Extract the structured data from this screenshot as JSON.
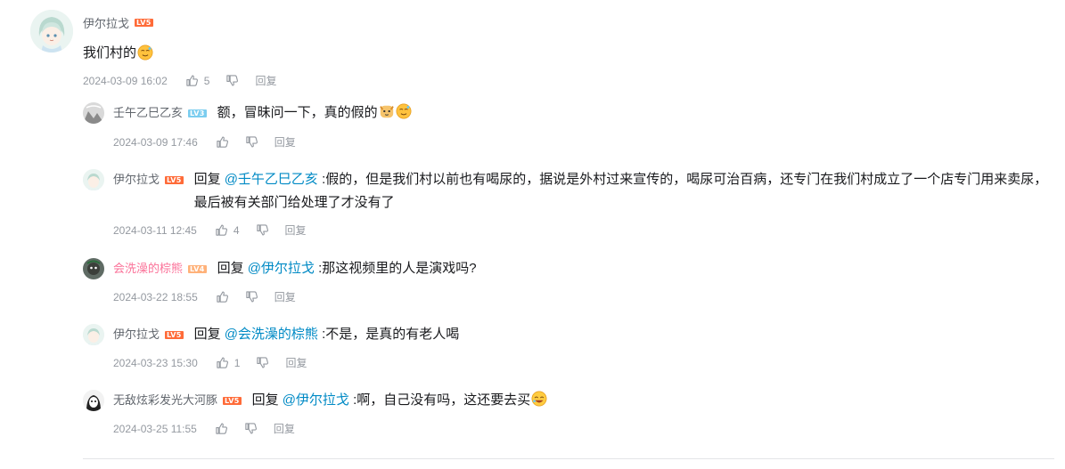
{
  "root": {
    "username": "伊尔拉戈",
    "level": "LV5",
    "text": "我们村的",
    "time": "2024-03-09 16:02",
    "likes": "5",
    "reply_label": "回复"
  },
  "replies": [
    {
      "username": "壬午乙巳乙亥",
      "level": "LV3",
      "prefix": "",
      "at": "",
      "text": "额，冒昧问一下，真的假的",
      "time": "2024-03-09 17:46",
      "likes": "",
      "reply_label": "回复"
    },
    {
      "username": "伊尔拉戈",
      "level": "LV5",
      "prefix": "回复",
      "at": "@壬午乙巳乙亥",
      "text": ":假的，但是我们村以前也有喝尿的，据说是外村过来宣传的，喝尿可治百病，还专门在我们村成立了一个店专门用来卖尿，最后被有关部门给处理了才没有了",
      "time": "2024-03-11 12:45",
      "likes": "4",
      "reply_label": "回复"
    },
    {
      "username": "会洗澡的棕熊",
      "level": "LV4",
      "prefix": "回复",
      "at": "@伊尔拉戈",
      "text": ":那这视频里的人是演戏吗?",
      "time": "2024-03-22 18:55",
      "likes": "",
      "reply_label": "回复"
    },
    {
      "username": "伊尔拉戈",
      "level": "LV5",
      "prefix": "回复",
      "at": "@会洗澡的棕熊",
      "text": ":不是，是真的有老人喝",
      "time": "2024-03-23 15:30",
      "likes": "1",
      "reply_label": "回复"
    },
    {
      "username": "无敌炫彩发光大河豚",
      "level": "LV5",
      "prefix": "回复",
      "at": "@伊尔拉戈",
      "text": ":啊，自己没有吗，这还要去买",
      "time": "2024-03-25 11:55",
      "likes": "",
      "reply_label": "回复"
    }
  ],
  "colors": {
    "lv5": "#ff6b38",
    "lv4": "#ffb27a",
    "lv3": "#7bcdef",
    "mention": "#008ac5",
    "vip_name": "#fb7299",
    "meta": "#9499a0"
  },
  "icons": {
    "like": "thumb-up-icon",
    "dislike": "thumb-down-icon",
    "emoji": "emoji-icon"
  }
}
